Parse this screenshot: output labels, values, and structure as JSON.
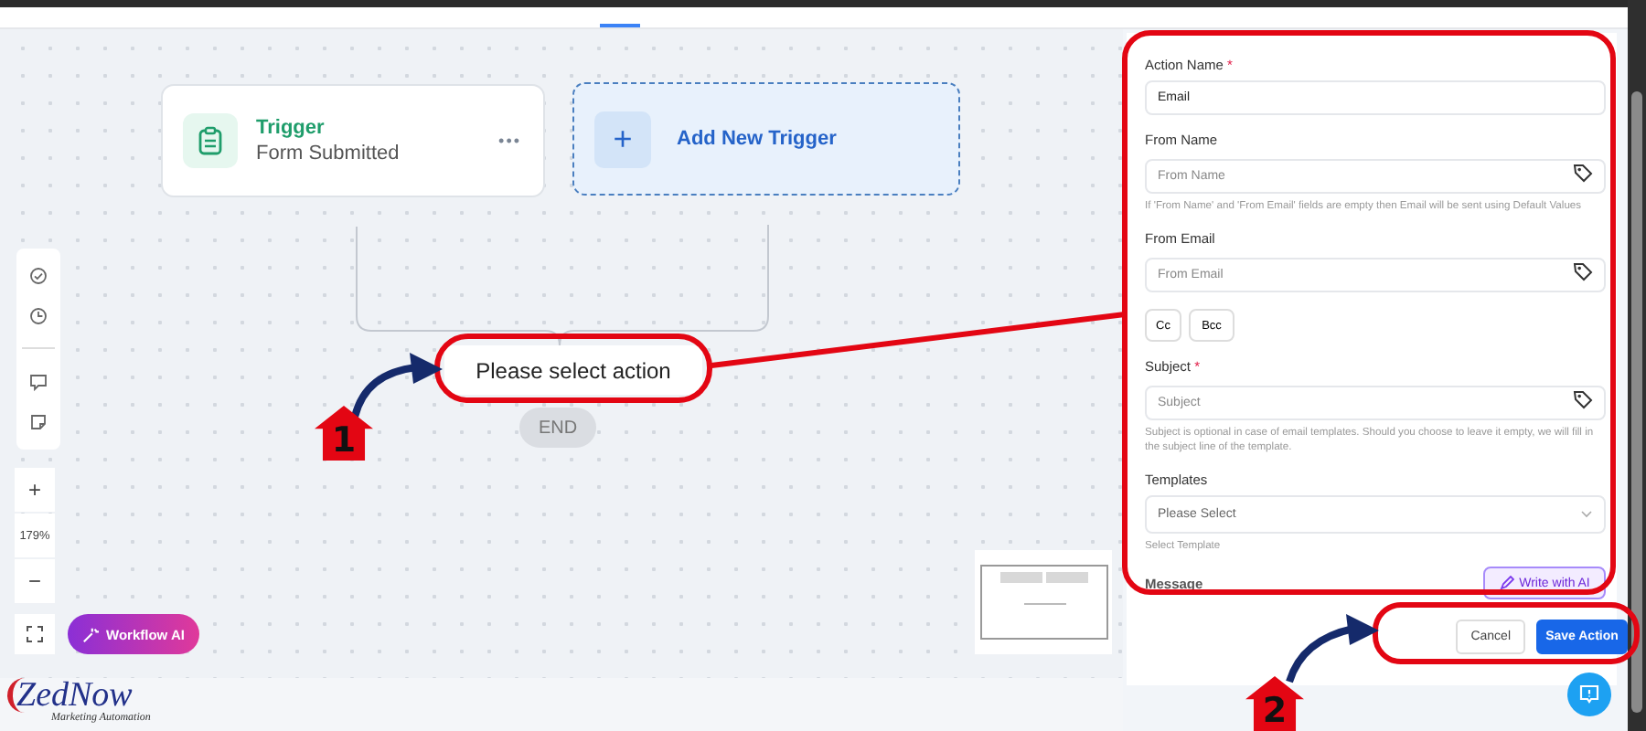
{
  "header": {
    "tabs": [
      {
        "selected": true
      }
    ]
  },
  "canvas": {
    "trigger_node": {
      "title": "Trigger",
      "subtitle": "Form Submitted",
      "menu": "•••"
    },
    "add_trigger": {
      "icon": "+",
      "label": "Add New Trigger"
    },
    "action_node": {
      "label": "Please select action"
    },
    "end_node": {
      "label": "END"
    },
    "zoom": {
      "zoom_in": "+",
      "level_text": "179%",
      "zoom_out": "−"
    },
    "workflow_ai": {
      "label": "Workflow AI"
    }
  },
  "panel": {
    "fields": [
      {
        "kind": "text",
        "label": "Action Name",
        "required_mark": "*",
        "value": "Email"
      },
      {
        "kind": "tagged",
        "label": "From Name",
        "placeholder": "From Name",
        "hint": "If 'From Name' and 'From Email' fields are empty then Email will be sent using Default Values"
      },
      {
        "kind": "tagged",
        "label": "From Email",
        "placeholder": "From Email"
      },
      {
        "kind": "chips",
        "chips": [
          "Cc",
          "Bcc"
        ]
      },
      {
        "kind": "tagged",
        "label": "Subject",
        "required_mark": "*",
        "placeholder": "Subject",
        "hint": "Subject is optional in case of email templates. Should you choose to leave it empty, we will fill in the subject line of the template."
      },
      {
        "kind": "select",
        "label": "Templates",
        "placeholder": "Please Select",
        "hint": "Select Template"
      },
      {
        "kind": "message",
        "label": "Message",
        "button": "Write with AI"
      }
    ],
    "buttons": [
      {
        "kind": "secondary",
        "label": "Cancel"
      },
      {
        "kind": "primary",
        "label": "Save Action"
      }
    ]
  },
  "annotations": [
    {
      "number": "1"
    },
    {
      "number": "2"
    }
  ],
  "logo": {
    "name": "ZedNow",
    "tagline": "Marketing Automation"
  }
}
